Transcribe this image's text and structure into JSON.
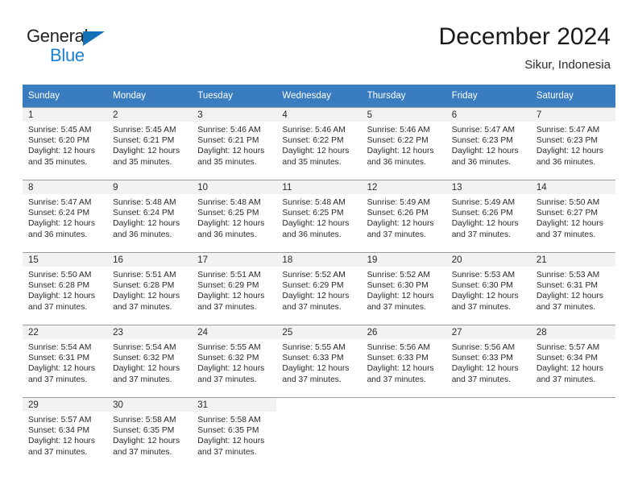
{
  "brand": {
    "name_top": "General",
    "name_bottom": "Blue",
    "triangle_color": "#1470b9",
    "blue_text_color": "#1a80cf"
  },
  "header": {
    "month_title": "December 2024",
    "location": "Sikur, Indonesia"
  },
  "theme": {
    "header_bg": "#3a7cc0",
    "header_text": "#ffffff",
    "daynum_band_bg": "#f2f2f2",
    "cell_bg": "#ffffff",
    "rule_color": "#9e9e9e",
    "body_text": "#2a2a2a"
  },
  "calendar": {
    "weekday_headers": [
      "Sunday",
      "Monday",
      "Tuesday",
      "Wednesday",
      "Thursday",
      "Friday",
      "Saturday"
    ],
    "weeks": [
      [
        {
          "day": "1",
          "sunrise": "Sunrise: 5:45 AM",
          "sunset": "Sunset: 6:20 PM",
          "daylight": "Daylight: 12 hours and 35 minutes."
        },
        {
          "day": "2",
          "sunrise": "Sunrise: 5:45 AM",
          "sunset": "Sunset: 6:21 PM",
          "daylight": "Daylight: 12 hours and 35 minutes."
        },
        {
          "day": "3",
          "sunrise": "Sunrise: 5:46 AM",
          "sunset": "Sunset: 6:21 PM",
          "daylight": "Daylight: 12 hours and 35 minutes."
        },
        {
          "day": "4",
          "sunrise": "Sunrise: 5:46 AM",
          "sunset": "Sunset: 6:22 PM",
          "daylight": "Daylight: 12 hours and 35 minutes."
        },
        {
          "day": "5",
          "sunrise": "Sunrise: 5:46 AM",
          "sunset": "Sunset: 6:22 PM",
          "daylight": "Daylight: 12 hours and 36 minutes."
        },
        {
          "day": "6",
          "sunrise": "Sunrise: 5:47 AM",
          "sunset": "Sunset: 6:23 PM",
          "daylight": "Daylight: 12 hours and 36 minutes."
        },
        {
          "day": "7",
          "sunrise": "Sunrise: 5:47 AM",
          "sunset": "Sunset: 6:23 PM",
          "daylight": "Daylight: 12 hours and 36 minutes."
        }
      ],
      [
        {
          "day": "8",
          "sunrise": "Sunrise: 5:47 AM",
          "sunset": "Sunset: 6:24 PM",
          "daylight": "Daylight: 12 hours and 36 minutes."
        },
        {
          "day": "9",
          "sunrise": "Sunrise: 5:48 AM",
          "sunset": "Sunset: 6:24 PM",
          "daylight": "Daylight: 12 hours and 36 minutes."
        },
        {
          "day": "10",
          "sunrise": "Sunrise: 5:48 AM",
          "sunset": "Sunset: 6:25 PM",
          "daylight": "Daylight: 12 hours and 36 minutes."
        },
        {
          "day": "11",
          "sunrise": "Sunrise: 5:48 AM",
          "sunset": "Sunset: 6:25 PM",
          "daylight": "Daylight: 12 hours and 36 minutes."
        },
        {
          "day": "12",
          "sunrise": "Sunrise: 5:49 AM",
          "sunset": "Sunset: 6:26 PM",
          "daylight": "Daylight: 12 hours and 37 minutes."
        },
        {
          "day": "13",
          "sunrise": "Sunrise: 5:49 AM",
          "sunset": "Sunset: 6:26 PM",
          "daylight": "Daylight: 12 hours and 37 minutes."
        },
        {
          "day": "14",
          "sunrise": "Sunrise: 5:50 AM",
          "sunset": "Sunset: 6:27 PM",
          "daylight": "Daylight: 12 hours and 37 minutes."
        }
      ],
      [
        {
          "day": "15",
          "sunrise": "Sunrise: 5:50 AM",
          "sunset": "Sunset: 6:28 PM",
          "daylight": "Daylight: 12 hours and 37 minutes."
        },
        {
          "day": "16",
          "sunrise": "Sunrise: 5:51 AM",
          "sunset": "Sunset: 6:28 PM",
          "daylight": "Daylight: 12 hours and 37 minutes."
        },
        {
          "day": "17",
          "sunrise": "Sunrise: 5:51 AM",
          "sunset": "Sunset: 6:29 PM",
          "daylight": "Daylight: 12 hours and 37 minutes."
        },
        {
          "day": "18",
          "sunrise": "Sunrise: 5:52 AM",
          "sunset": "Sunset: 6:29 PM",
          "daylight": "Daylight: 12 hours and 37 minutes."
        },
        {
          "day": "19",
          "sunrise": "Sunrise: 5:52 AM",
          "sunset": "Sunset: 6:30 PM",
          "daylight": "Daylight: 12 hours and 37 minutes."
        },
        {
          "day": "20",
          "sunrise": "Sunrise: 5:53 AM",
          "sunset": "Sunset: 6:30 PM",
          "daylight": "Daylight: 12 hours and 37 minutes."
        },
        {
          "day": "21",
          "sunrise": "Sunrise: 5:53 AM",
          "sunset": "Sunset: 6:31 PM",
          "daylight": "Daylight: 12 hours and 37 minutes."
        }
      ],
      [
        {
          "day": "22",
          "sunrise": "Sunrise: 5:54 AM",
          "sunset": "Sunset: 6:31 PM",
          "daylight": "Daylight: 12 hours and 37 minutes."
        },
        {
          "day": "23",
          "sunrise": "Sunrise: 5:54 AM",
          "sunset": "Sunset: 6:32 PM",
          "daylight": "Daylight: 12 hours and 37 minutes."
        },
        {
          "day": "24",
          "sunrise": "Sunrise: 5:55 AM",
          "sunset": "Sunset: 6:32 PM",
          "daylight": "Daylight: 12 hours and 37 minutes."
        },
        {
          "day": "25",
          "sunrise": "Sunrise: 5:55 AM",
          "sunset": "Sunset: 6:33 PM",
          "daylight": "Daylight: 12 hours and 37 minutes."
        },
        {
          "day": "26",
          "sunrise": "Sunrise: 5:56 AM",
          "sunset": "Sunset: 6:33 PM",
          "daylight": "Daylight: 12 hours and 37 minutes."
        },
        {
          "day": "27",
          "sunrise": "Sunrise: 5:56 AM",
          "sunset": "Sunset: 6:33 PM",
          "daylight": "Daylight: 12 hours and 37 minutes."
        },
        {
          "day": "28",
          "sunrise": "Sunrise: 5:57 AM",
          "sunset": "Sunset: 6:34 PM",
          "daylight": "Daylight: 12 hours and 37 minutes."
        }
      ],
      [
        {
          "day": "29",
          "sunrise": "Sunrise: 5:57 AM",
          "sunset": "Sunset: 6:34 PM",
          "daylight": "Daylight: 12 hours and 37 minutes."
        },
        {
          "day": "30",
          "sunrise": "Sunrise: 5:58 AM",
          "sunset": "Sunset: 6:35 PM",
          "daylight": "Daylight: 12 hours and 37 minutes."
        },
        {
          "day": "31",
          "sunrise": "Sunrise: 5:58 AM",
          "sunset": "Sunset: 6:35 PM",
          "daylight": "Daylight: 12 hours and 37 minutes."
        },
        {
          "day": "",
          "sunrise": "",
          "sunset": "",
          "daylight": ""
        },
        {
          "day": "",
          "sunrise": "",
          "sunset": "",
          "daylight": ""
        },
        {
          "day": "",
          "sunrise": "",
          "sunset": "",
          "daylight": ""
        },
        {
          "day": "",
          "sunrise": "",
          "sunset": "",
          "daylight": ""
        }
      ]
    ]
  }
}
